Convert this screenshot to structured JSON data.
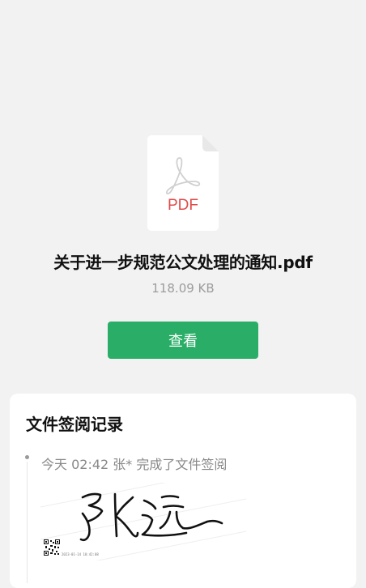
{
  "file": {
    "icon_label": "PDF",
    "name": "关于进一步规范公文处理的通知.pdf",
    "size": "118.09 KB"
  },
  "actions": {
    "view_label": "查看"
  },
  "records": {
    "title": "文件签阅记录",
    "items": [
      {
        "text": "今天 02:42  张*  完成了文件签阅",
        "signature_timestamp": "2023-01-14 10:42:08"
      }
    ]
  },
  "colors": {
    "background": "#f2f2f2",
    "accent": "#2aae67",
    "pdf_red": "#e04b4b"
  }
}
